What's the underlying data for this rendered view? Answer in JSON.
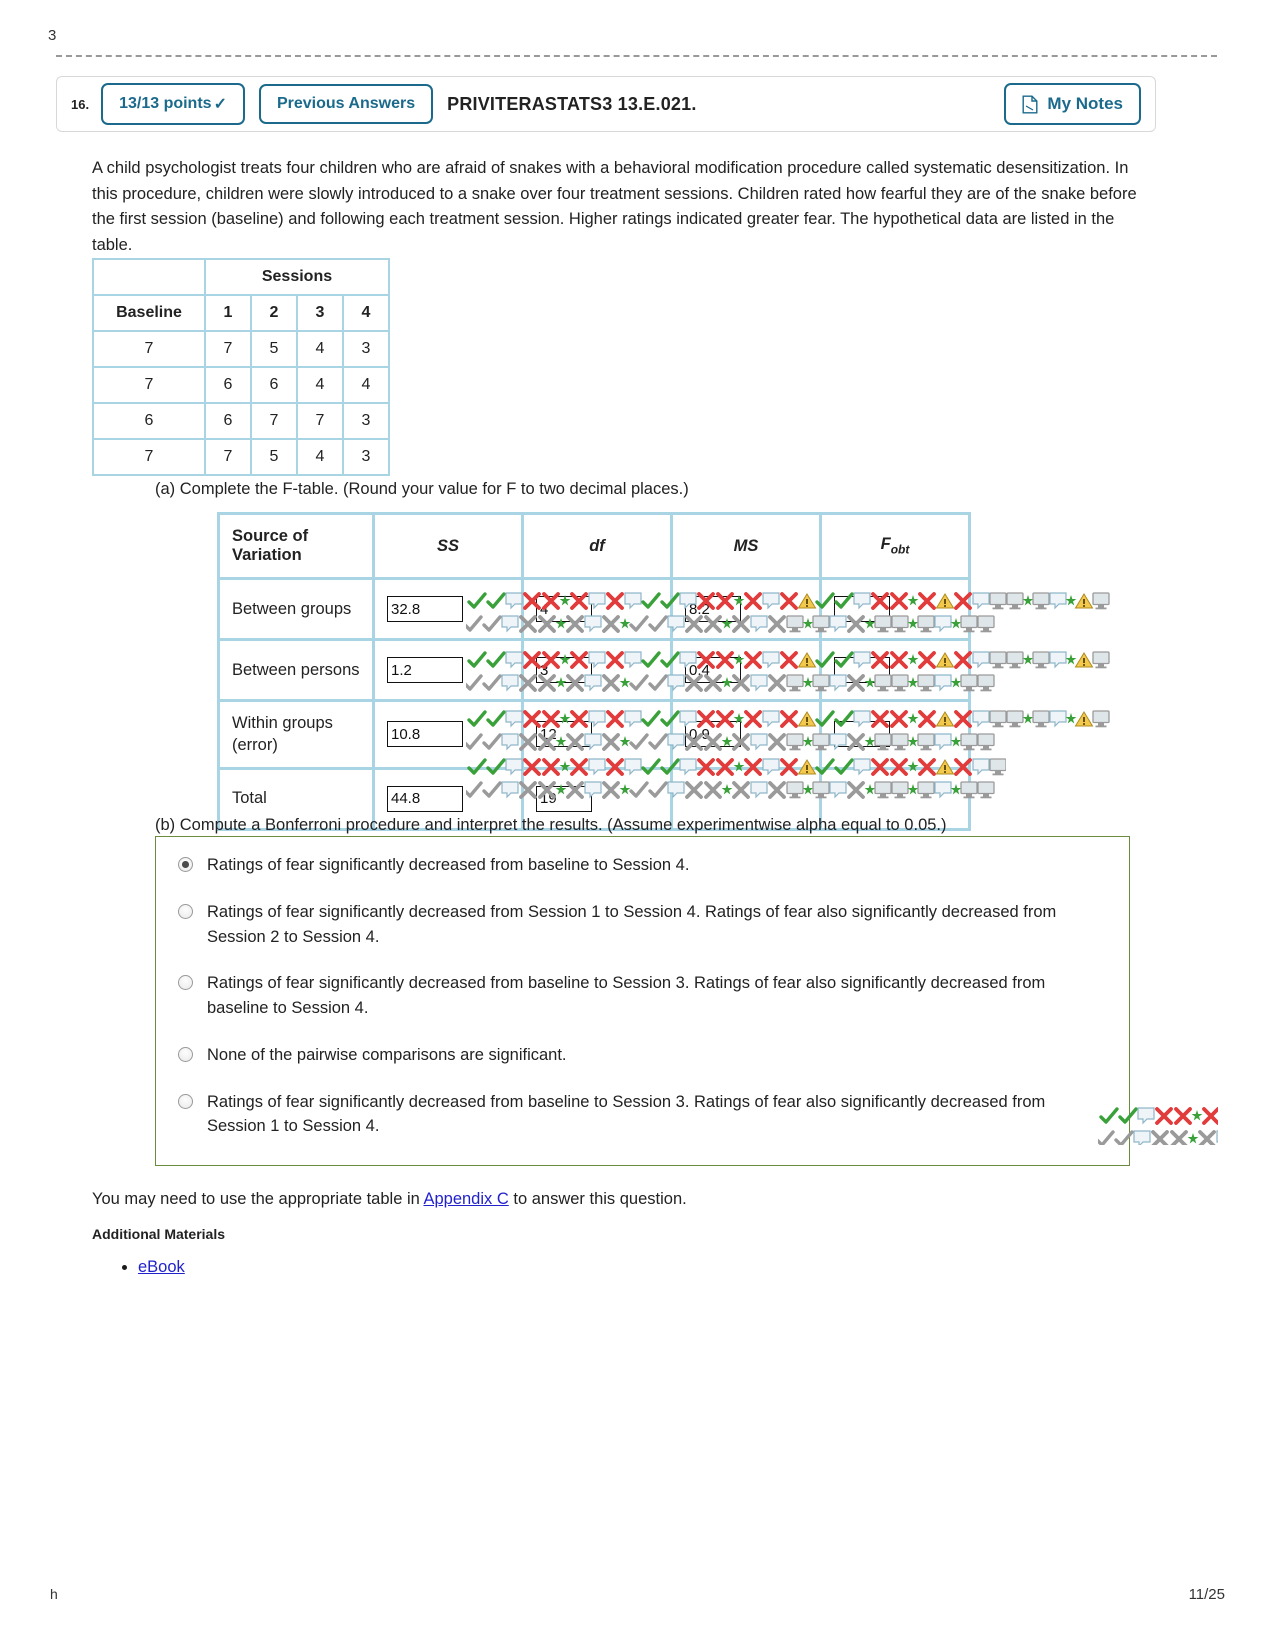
{
  "top_clip_glyph": "3",
  "header": {
    "question_number": "16.",
    "points_label": "13/13 points",
    "points_check": "✓",
    "previous_answers_label": "Previous Answers",
    "exercise_id": "PRIVITERASTATS3 13.E.021.",
    "my_notes_label": "My Notes",
    "notes_icon": "note-page-icon"
  },
  "prompt": "A child psychologist treats four children who are afraid of snakes with a behavioral modification procedure called systematic desensitization. In this procedure, children were slowly introduced to a snake over four treatment sessions. Children rated how fearful they are of the snake before the first session (baseline) and following each treatment session. Higher ratings indicated greater fear. The hypothetical data are listed in the table.",
  "data_table": {
    "group_header": "Sessions",
    "baseline_header": "Baseline",
    "session_headers": [
      "1",
      "2",
      "3",
      "4"
    ],
    "rows": [
      {
        "baseline": "7",
        "sessions": [
          "7",
          "5",
          "4",
          "3"
        ]
      },
      {
        "baseline": "7",
        "sessions": [
          "6",
          "6",
          "4",
          "4"
        ]
      },
      {
        "baseline": "6",
        "sessions": [
          "6",
          "7",
          "7",
          "3"
        ]
      },
      {
        "baseline": "7",
        "sessions": [
          "7",
          "5",
          "4",
          "3"
        ]
      }
    ]
  },
  "part_a": {
    "label": "(a) Complete the F-table. (Round your value for F to two decimal places.)",
    "columns": [
      "Source of Variation",
      "SS",
      "df",
      "MS",
      "Fobt"
    ],
    "col_ss": "SS",
    "col_df": "df",
    "col_ms": "MS",
    "col_f": "F",
    "col_f_sub": "obt",
    "rows": [
      {
        "source": "Between groups",
        "ss": "32.8",
        "df": "4",
        "ms": "8.2",
        "fobt": ""
      },
      {
        "source": "Between persons",
        "ss": "1.2",
        "df": "3",
        "ms": "0.4",
        "fobt": ""
      },
      {
        "source": "Within groups (error)",
        "ss": "10.8",
        "df": "12",
        "ms": "0.9",
        "fobt": ""
      },
      {
        "source": "Total",
        "ss": "44.8",
        "df": "19",
        "ms": "",
        "fobt": ""
      }
    ]
  },
  "part_b": {
    "label": "(b) Compute a Bonferroni procedure and interpret the results. (Assume experimentwise alpha equal to 0.05.)",
    "options": [
      {
        "text": "Ratings of fear significantly decreased from baseline to Session 4.",
        "selected": true
      },
      {
        "text": "Ratings of fear significantly decreased from Session 1 to Session 4. Ratings of fear also significantly decreased from Session 2 to Session 4.",
        "selected": false
      },
      {
        "text": "Ratings of fear significantly decreased from baseline to Session 3. Ratings of fear also significantly decreased from baseline to Session 4.",
        "selected": false
      },
      {
        "text": "None of the pairwise comparisons are significant.",
        "selected": false
      },
      {
        "text": "Ratings of fear significantly decreased from baseline to Session 3. Ratings of fear also significantly decreased from Session 1 to Session 4.",
        "selected": false
      }
    ]
  },
  "appendix": {
    "text_before": "You may need to use the appropriate table in ",
    "link_label": "Appendix C",
    "text_after": " to answer this question."
  },
  "additional_materials": {
    "heading": "Additional Materials",
    "items": [
      "eBook"
    ]
  },
  "footer": {
    "left": "h",
    "page": "11/25"
  },
  "colors": {
    "accent_blue": "#1b6a8c",
    "table_border_blue": "#a8d4e4",
    "choices_border_green": "#6b8c3f",
    "link_blue": "#2222cc",
    "check_green": "#3aa13a",
    "cross_red": "#e23b3b",
    "gray_icon": "#9a9a9a",
    "warn_yellow": "#f2c94c"
  }
}
